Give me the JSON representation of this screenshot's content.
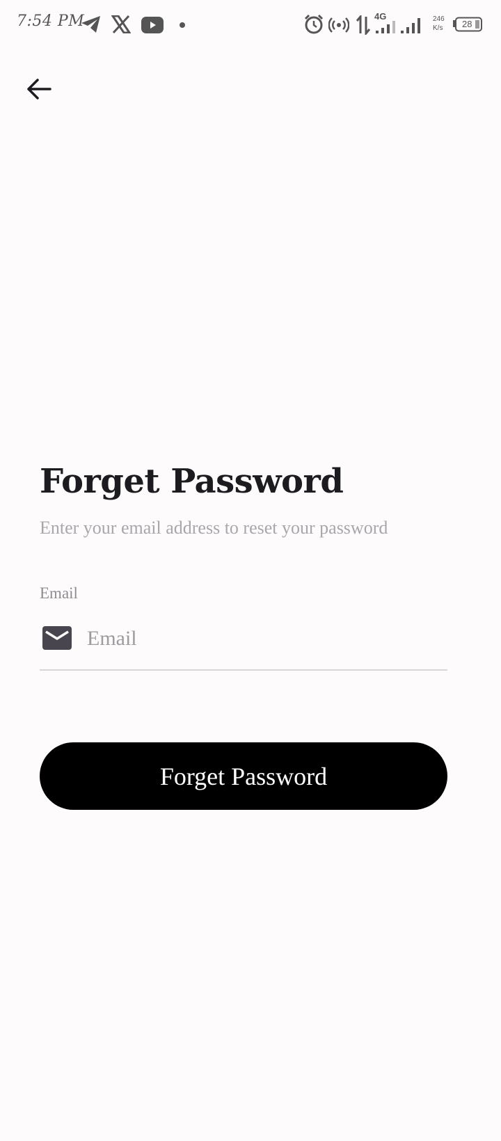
{
  "status_bar": {
    "time": "7:54 PM",
    "network_type": "4G",
    "speed_value": "246",
    "speed_unit": "K/s",
    "battery": "28",
    "icons": [
      "telegram-icon",
      "x-icon",
      "youtube-icon",
      "dot-icon",
      "alarm-icon",
      "hotspot-icon",
      "data-arrows-icon",
      "signal-icon",
      "signal-icon",
      "battery-icon"
    ]
  },
  "header": {
    "back_icon": "arrow-left-icon"
  },
  "main": {
    "title": "Forget Password",
    "subtitle": "Enter your email address to reset your password",
    "email_label": "Email",
    "email_placeholder": "Email",
    "email_value": "",
    "email_icon": "mail-icon",
    "submit_label": "Forget Password"
  },
  "colors": {
    "background": "#fefbfd",
    "title": "#1c1b1f",
    "subtitle": "#a9a6ab",
    "button_bg": "#000000",
    "button_text": "#ffffff",
    "icon": "#49454f"
  }
}
